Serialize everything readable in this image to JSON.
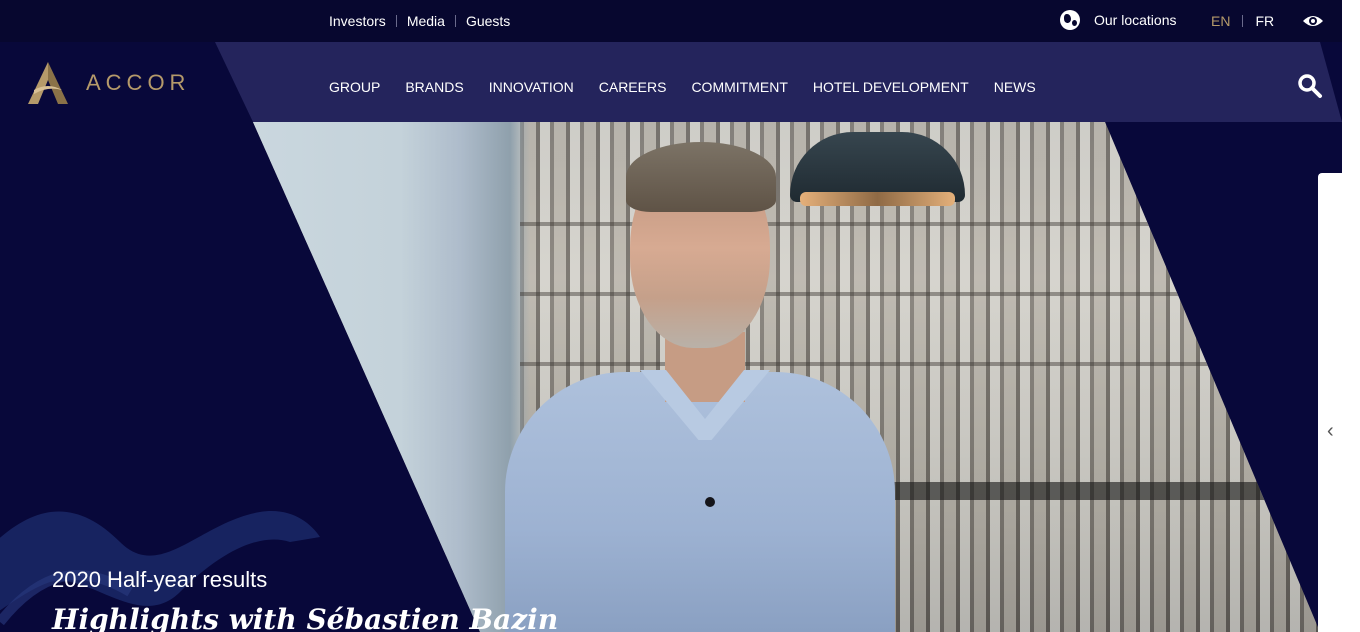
{
  "topbar": {
    "links": [
      "Investors",
      "Media",
      "Guests"
    ],
    "locations_label": "Our locations",
    "languages": [
      "EN",
      "FR"
    ]
  },
  "brand": {
    "name": "ACCOR",
    "accent": "#b59a6a"
  },
  "nav": {
    "items": [
      "GROUP",
      "BRANDS",
      "INNOVATION",
      "CAREERS",
      "COMMITMENT",
      "HOTEL DEVELOPMENT",
      "NEWS"
    ]
  },
  "hero": {
    "subtitle": "2020 Half-year results",
    "title": "Highlights with Sébastien Bazin"
  },
  "icons": [
    "globe-icon",
    "accessibility-icon",
    "search-icon",
    "chevron-left-icon"
  ]
}
